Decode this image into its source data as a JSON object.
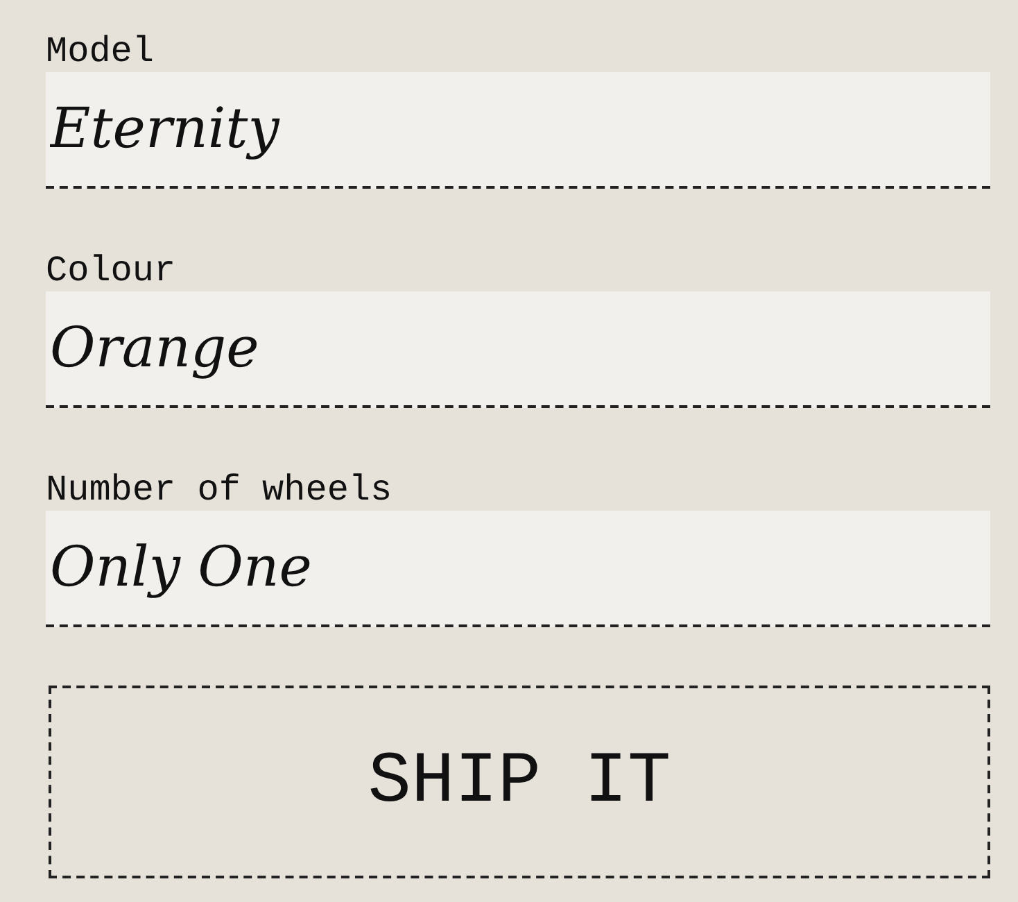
{
  "fields": [
    {
      "label": "Model",
      "value": "Eternity"
    },
    {
      "label": "Colour",
      "value": "Orange"
    },
    {
      "label": "Number of wheels",
      "value": "Only One"
    }
  ],
  "button": {
    "label": "SHIP IT"
  }
}
